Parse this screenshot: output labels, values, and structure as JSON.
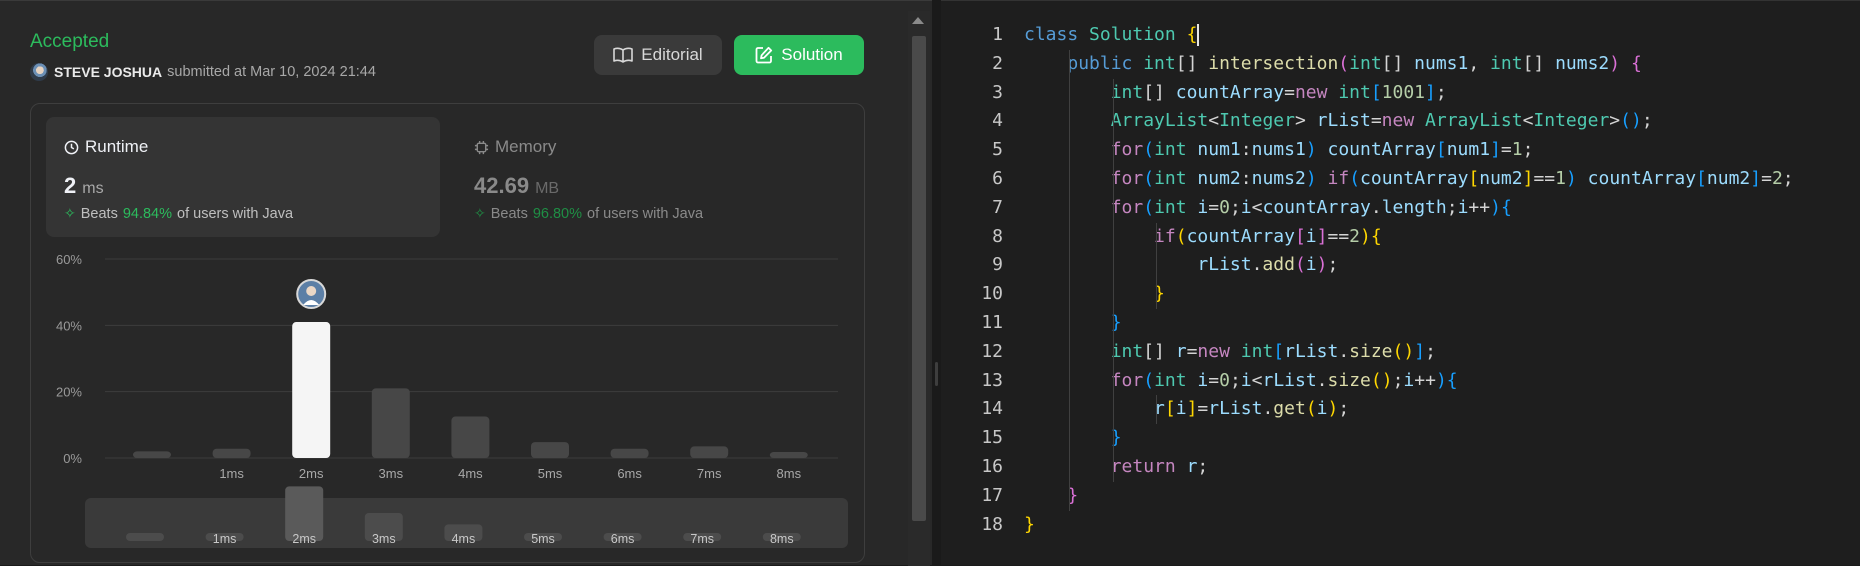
{
  "submission": {
    "status": "Accepted",
    "user_name": "STEVE JOSHUA",
    "submitted_text": "submitted at Mar 10, 2024 21:44"
  },
  "actions": {
    "editorial_label": "Editorial",
    "solution_label": "Solution"
  },
  "runtime": {
    "label": "Runtime",
    "value": "2",
    "unit": "ms",
    "beats_prefix": "Beats",
    "beats_pct": "94.84%",
    "beats_suffix": "of users with Java"
  },
  "memory": {
    "label": "Memory",
    "value": "42.69",
    "unit": "MB",
    "beats_prefix": "Beats",
    "beats_pct": "96.80%",
    "beats_suffix": "of users with Java"
  },
  "chart_data": {
    "type": "bar",
    "categories": [
      "",
      "1ms",
      "2ms",
      "3ms",
      "4ms",
      "5ms",
      "6ms",
      "7ms",
      "8ms"
    ],
    "values": [
      2,
      2.8,
      41,
      21,
      12.5,
      4.8,
      2.8,
      3.5,
      1.8
    ],
    "highlight_index": 2,
    "y_ticks": [
      "60%",
      "40%",
      "20%",
      "0%"
    ],
    "ylim": [
      0,
      60
    ],
    "grid": true,
    "overview_values": [
      2,
      2.8,
      41,
      21,
      12.5,
      4.8,
      2.8,
      3.5,
      1.8
    ]
  },
  "colors": {
    "accent_green": "#2cbb5d",
    "bar": "#474747",
    "bar_highlight": "#f5f5f5"
  },
  "code": {
    "lines": [
      [
        [
          "class ",
          "#569cd6"
        ],
        [
          "Solution ",
          "#4ec9b0"
        ],
        [
          "{",
          "#ffd700"
        ]
      ],
      [
        [
          "    "
        ],
        [
          "public ",
          "#569cd6"
        ],
        [
          "int",
          "#4ec9b0"
        ],
        [
          "[] ",
          "#d4d4d4"
        ],
        [
          "intersection",
          "#dcdcaa"
        ],
        [
          "(",
          "#da70d6"
        ],
        [
          "int",
          "#4ec9b0"
        ],
        [
          "[] ",
          "#d4d4d4"
        ],
        [
          "nums1",
          "#9cdcfe"
        ],
        [
          ", ",
          "#d4d4d4"
        ],
        [
          "int",
          "#4ec9b0"
        ],
        [
          "[] ",
          "#d4d4d4"
        ],
        [
          "nums2",
          "#9cdcfe"
        ],
        [
          ") ",
          "#da70d6"
        ],
        [
          "{",
          "#da70d6"
        ]
      ],
      [
        [
          "        "
        ],
        [
          "int",
          "#4ec9b0"
        ],
        [
          "[] ",
          "#d4d4d4"
        ],
        [
          "countArray",
          "#9cdcfe"
        ],
        [
          "=",
          "#d4d4d4"
        ],
        [
          "new ",
          "#c586c0"
        ],
        [
          "int",
          "#4ec9b0"
        ],
        [
          "[",
          "#179fff"
        ],
        [
          "1001",
          "#b5cea8"
        ],
        [
          "]",
          "#179fff"
        ],
        [
          ";",
          "#d4d4d4"
        ]
      ],
      [
        [
          "        "
        ],
        [
          "ArrayList",
          "#4ec9b0"
        ],
        [
          "<",
          "#d4d4d4"
        ],
        [
          "Integer",
          "#4ec9b0"
        ],
        [
          "> ",
          "#d4d4d4"
        ],
        [
          "rList",
          "#9cdcfe"
        ],
        [
          "=",
          "#d4d4d4"
        ],
        [
          "new ",
          "#c586c0"
        ],
        [
          "ArrayList",
          "#4ec9b0"
        ],
        [
          "<",
          "#d4d4d4"
        ],
        [
          "Integer",
          "#4ec9b0"
        ],
        [
          ">",
          "#d4d4d4"
        ],
        [
          "()",
          "#179fff"
        ],
        [
          ";",
          "#d4d4d4"
        ]
      ],
      [
        [
          "        "
        ],
        [
          "for",
          "#c586c0"
        ],
        [
          "(",
          "#179fff"
        ],
        [
          "int ",
          "#4ec9b0"
        ],
        [
          "num1",
          "#9cdcfe"
        ],
        [
          ":",
          "#d4d4d4"
        ],
        [
          "nums1",
          "#9cdcfe"
        ],
        [
          ") ",
          "#179fff"
        ],
        [
          "countArray",
          "#9cdcfe"
        ],
        [
          "[",
          "#179fff"
        ],
        [
          "num1",
          "#9cdcfe"
        ],
        [
          "]",
          "#179fff"
        ],
        [
          "=",
          "#d4d4d4"
        ],
        [
          "1",
          "#b5cea8"
        ],
        [
          ";",
          "#d4d4d4"
        ]
      ],
      [
        [
          "        "
        ],
        [
          "for",
          "#c586c0"
        ],
        [
          "(",
          "#179fff"
        ],
        [
          "int ",
          "#4ec9b0"
        ],
        [
          "num2",
          "#9cdcfe"
        ],
        [
          ":",
          "#d4d4d4"
        ],
        [
          "nums2",
          "#9cdcfe"
        ],
        [
          ") ",
          "#179fff"
        ],
        [
          "if",
          "#c586c0"
        ],
        [
          "(",
          "#179fff"
        ],
        [
          "countArray",
          "#9cdcfe"
        ],
        [
          "[",
          "#ffd700"
        ],
        [
          "num2",
          "#9cdcfe"
        ],
        [
          "]",
          "#ffd700"
        ],
        [
          "==",
          "#d4d4d4"
        ],
        [
          "1",
          "#b5cea8"
        ],
        [
          ") ",
          "#179fff"
        ],
        [
          "countArray",
          "#9cdcfe"
        ],
        [
          "[",
          "#179fff"
        ],
        [
          "num2",
          "#9cdcfe"
        ],
        [
          "]",
          "#179fff"
        ],
        [
          "=",
          "#d4d4d4"
        ],
        [
          "2",
          "#b5cea8"
        ],
        [
          ";",
          "#d4d4d4"
        ]
      ],
      [
        [
          "        "
        ],
        [
          "for",
          "#c586c0"
        ],
        [
          "(",
          "#179fff"
        ],
        [
          "int ",
          "#4ec9b0"
        ],
        [
          "i",
          "#9cdcfe"
        ],
        [
          "=",
          "#d4d4d4"
        ],
        [
          "0",
          "#b5cea8"
        ],
        [
          ";",
          "#d4d4d4"
        ],
        [
          "i",
          "#9cdcfe"
        ],
        [
          "<",
          "#d4d4d4"
        ],
        [
          "countArray",
          "#9cdcfe"
        ],
        [
          ".",
          "#d4d4d4"
        ],
        [
          "length",
          "#9cdcfe"
        ],
        [
          ";",
          "#d4d4d4"
        ],
        [
          "i",
          "#9cdcfe"
        ],
        [
          "++",
          "#d4d4d4"
        ],
        [
          ")",
          "#179fff"
        ],
        [
          "{",
          "#179fff"
        ]
      ],
      [
        [
          "            "
        ],
        [
          "if",
          "#c586c0"
        ],
        [
          "(",
          "#ffd700"
        ],
        [
          "countArray",
          "#9cdcfe"
        ],
        [
          "[",
          "#da70d6"
        ],
        [
          "i",
          "#9cdcfe"
        ],
        [
          "]",
          "#da70d6"
        ],
        [
          "==",
          "#d4d4d4"
        ],
        [
          "2",
          "#b5cea8"
        ],
        [
          ")",
          "#ffd700"
        ],
        [
          "{",
          "#ffd700"
        ]
      ],
      [
        [
          "                "
        ],
        [
          "rList",
          "#9cdcfe"
        ],
        [
          ".",
          "#d4d4d4"
        ],
        [
          "add",
          "#dcdcaa"
        ],
        [
          "(",
          "#da70d6"
        ],
        [
          "i",
          "#9cdcfe"
        ],
        [
          ")",
          "#da70d6"
        ],
        [
          ";",
          "#d4d4d4"
        ]
      ],
      [
        [
          "            "
        ],
        [
          "}",
          "#ffd700"
        ]
      ],
      [
        [
          "        "
        ],
        [
          "}",
          "#179fff"
        ]
      ],
      [
        [
          "        "
        ],
        [
          "int",
          "#4ec9b0"
        ],
        [
          "[] ",
          "#d4d4d4"
        ],
        [
          "r",
          "#9cdcfe"
        ],
        [
          "=",
          "#d4d4d4"
        ],
        [
          "new ",
          "#c586c0"
        ],
        [
          "int",
          "#4ec9b0"
        ],
        [
          "[",
          "#179fff"
        ],
        [
          "rList",
          "#9cdcfe"
        ],
        [
          ".",
          "#d4d4d4"
        ],
        [
          "size",
          "#dcdcaa"
        ],
        [
          "()",
          "#ffd700"
        ],
        [
          "]",
          "#179fff"
        ],
        [
          ";",
          "#d4d4d4"
        ]
      ],
      [
        [
          "        "
        ],
        [
          "for",
          "#c586c0"
        ],
        [
          "(",
          "#179fff"
        ],
        [
          "int ",
          "#4ec9b0"
        ],
        [
          "i",
          "#9cdcfe"
        ],
        [
          "=",
          "#d4d4d4"
        ],
        [
          "0",
          "#b5cea8"
        ],
        [
          ";",
          "#d4d4d4"
        ],
        [
          "i",
          "#9cdcfe"
        ],
        [
          "<",
          "#d4d4d4"
        ],
        [
          "rList",
          "#9cdcfe"
        ],
        [
          ".",
          "#d4d4d4"
        ],
        [
          "size",
          "#dcdcaa"
        ],
        [
          "()",
          "#ffd700"
        ],
        [
          ";",
          "#d4d4d4"
        ],
        [
          "i",
          "#9cdcfe"
        ],
        [
          "++",
          "#d4d4d4"
        ],
        [
          ")",
          "#179fff"
        ],
        [
          "{",
          "#179fff"
        ]
      ],
      [
        [
          "            "
        ],
        [
          "r",
          "#9cdcfe"
        ],
        [
          "[",
          "#ffd700"
        ],
        [
          "i",
          "#9cdcfe"
        ],
        [
          "]",
          "#ffd700"
        ],
        [
          "=",
          "#d4d4d4"
        ],
        [
          "rList",
          "#9cdcfe"
        ],
        [
          ".",
          "#d4d4d4"
        ],
        [
          "get",
          "#dcdcaa"
        ],
        [
          "(",
          "#ffd700"
        ],
        [
          "i",
          "#9cdcfe"
        ],
        [
          ")",
          "#ffd700"
        ],
        [
          ";",
          "#d4d4d4"
        ]
      ],
      [
        [
          "        "
        ],
        [
          "}",
          "#179fff"
        ]
      ],
      [
        [
          "        "
        ],
        [
          "return ",
          "#c586c0"
        ],
        [
          "r",
          "#9cdcfe"
        ],
        [
          ";",
          "#d4d4d4"
        ]
      ],
      [
        [
          "    "
        ],
        [
          "}",
          "#da70d6"
        ]
      ],
      [
        [
          "}",
          "#ffd700"
        ]
      ]
    ]
  }
}
